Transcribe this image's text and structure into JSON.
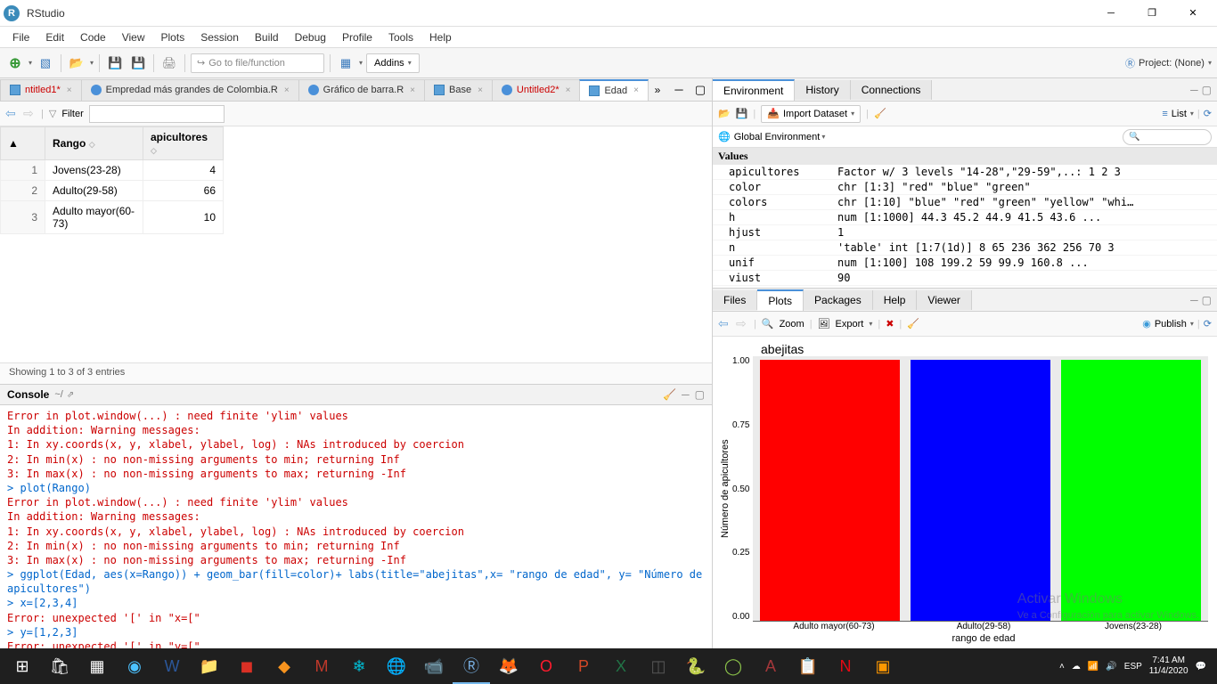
{
  "window": {
    "title": "RStudio"
  },
  "menu": [
    "File",
    "Edit",
    "Code",
    "View",
    "Plots",
    "Session",
    "Build",
    "Debug",
    "Profile",
    "Tools",
    "Help"
  ],
  "toolbar": {
    "gotofile_placeholder": "Go to file/function",
    "addins_label": "Addins",
    "project_label": "Project: (None)"
  },
  "source_tabs": [
    {
      "label": "ntitled1*",
      "red": true,
      "icon": "table"
    },
    {
      "label": "Empredad más grandes de Colombia.R",
      "icon": "r"
    },
    {
      "label": "Gráfico de barra.R",
      "icon": "r"
    },
    {
      "label": "Base",
      "icon": "table"
    },
    {
      "label": "Untitled2*",
      "red": true,
      "icon": "r"
    },
    {
      "label": "Edad",
      "icon": "table",
      "active": true
    }
  ],
  "filter": {
    "label": "Filter",
    "placeholder": ""
  },
  "data_view": {
    "headers": [
      "",
      "Rango",
      "apicultores"
    ],
    "rows": [
      {
        "n": "1",
        "Rango": "Jovens(23-28)",
        "apicultores": "4"
      },
      {
        "n": "2",
        "Rango": "Adulto(29-58)",
        "apicultores": "66"
      },
      {
        "n": "3",
        "Rango": "Adulto mayor(60-73)",
        "apicultores": "10"
      }
    ],
    "status": "Showing 1 to 3 of 3 entries"
  },
  "console": {
    "title": "Console",
    "path": "~/",
    "lines": [
      {
        "t": "err",
        "text": "Error in plot.window(...) : need finite 'ylim' values"
      },
      {
        "t": "err",
        "text": "In addition: Warning messages:"
      },
      {
        "t": "err",
        "text": "1: In xy.coords(x, y, xlabel, ylabel, log) : NAs introduced by coercion"
      },
      {
        "t": "err",
        "text": "2: In min(x) : no non-missing arguments to min; returning Inf"
      },
      {
        "t": "err",
        "text": "3: In max(x) : no non-missing arguments to max; returning -Inf"
      },
      {
        "t": "cmd",
        "text": "> plot(Rango)"
      },
      {
        "t": "err",
        "text": "Error in plot.window(...) : need finite 'ylim' values"
      },
      {
        "t": "err",
        "text": "In addition: Warning messages:"
      },
      {
        "t": "err",
        "text": "1: In xy.coords(x, y, xlabel, ylabel, log) : NAs introduced by coercion"
      },
      {
        "t": "err",
        "text": "2: In min(x) : no non-missing arguments to min; returning Inf"
      },
      {
        "t": "err",
        "text": "3: In max(x) : no non-missing arguments to max; returning -Inf"
      },
      {
        "t": "cmd",
        "text": "> ggplot(Edad, aes(x=Rango)) + geom_bar(fill=color)+ labs(title=\"abejitas\",x= \"rango de edad\", y= \"Número de apicultores\")"
      },
      {
        "t": "cmd",
        "text": "> x=[2,3,4]"
      },
      {
        "t": "err",
        "text": "Error: unexpected '[' in \"x=[\""
      },
      {
        "t": "cmd",
        "text": "> y=[1,2,3]"
      },
      {
        "t": "err",
        "text": "Error: unexpected '[' in \"y=[\""
      }
    ]
  },
  "env_tabs": [
    "Environment",
    "History",
    "Connections"
  ],
  "env_tools": {
    "import": "Import Dataset",
    "list": "List",
    "scope": "Global Environment"
  },
  "env": {
    "group": "Values",
    "rows": [
      {
        "name": "apicultores",
        "val": "Factor w/ 3 levels \"14-28\",\"29-59\",..: 1 2 3"
      },
      {
        "name": "color",
        "val": "chr [1:3] \"red\" \"blue\" \"green\""
      },
      {
        "name": "colors",
        "val": "chr [1:10] \"blue\" \"red\" \"green\" \"yellow\" \"whi…"
      },
      {
        "name": "h",
        "val": "num [1:1000] 44.3 45.2 44.9 41.5 43.6 ..."
      },
      {
        "name": "hjust",
        "val": "1"
      },
      {
        "name": "n",
        "val": "'table' int [1:7(1d)] 8 65 236 362 256 70 3"
      },
      {
        "name": "unif",
        "val": "num [1:100] 108 199.2 59 99.9 160.8 ..."
      },
      {
        "name": "viust",
        "val": "90"
      }
    ]
  },
  "plot_tabs": [
    "Files",
    "Plots",
    "Packages",
    "Help",
    "Viewer"
  ],
  "plot_tools": {
    "zoom": "Zoom",
    "export": "Export",
    "publish": "Publish"
  },
  "chart_data": {
    "type": "bar",
    "title": "abejitas",
    "xlabel": "rango de edad",
    "ylabel": "Número de apicultores",
    "categories": [
      "Adulto mayor(60-73)",
      "Adulto(29-58)",
      "Jovens(23-28)"
    ],
    "values": [
      1,
      1,
      1
    ],
    "colors": [
      "#ff0000",
      "#0000ff",
      "#00ff00"
    ],
    "ylim": [
      0,
      1
    ],
    "yticks": [
      "0.00",
      "0.25",
      "0.50",
      "0.75",
      "1.00"
    ]
  },
  "watermark": {
    "line1": "Activar Windows",
    "line2": "Ve a Configuración para activar Windows."
  },
  "system": {
    "lang": "ESP",
    "time": "7:41 AM",
    "date": "11/4/2020"
  }
}
